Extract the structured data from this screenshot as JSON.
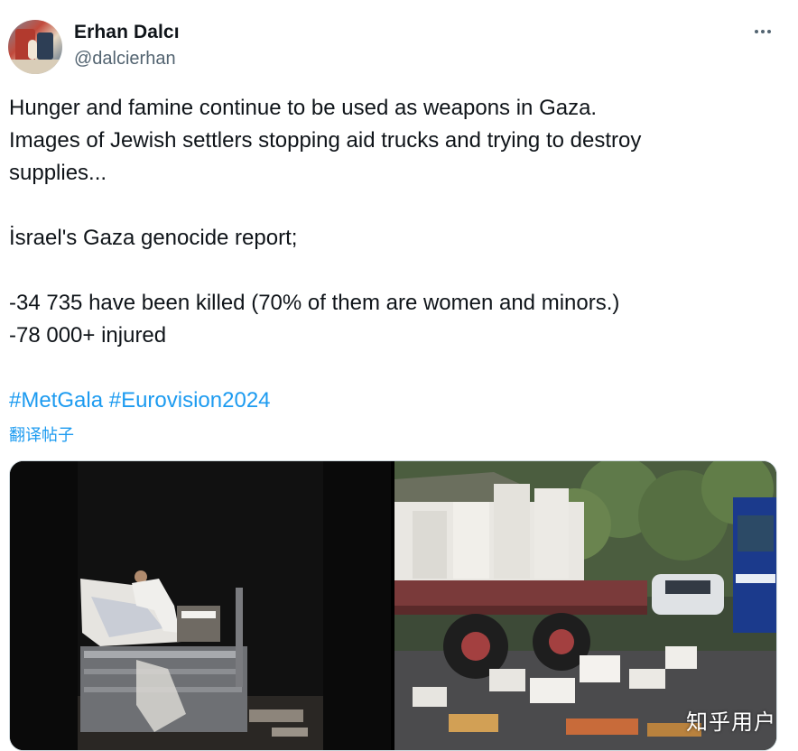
{
  "author": {
    "name": "Erhan Dalcı",
    "handle": "@dalcierhan"
  },
  "tweet": {
    "lines": [
      "Hunger and famine continue to be used as weapons in Gaza.",
      "Images of Jewish settlers stopping aid trucks and trying to destroy",
      "supplies...",
      "",
      "İsrael's Gaza genocide report;",
      "",
      "-34 735 have been killed (70% of them are women and minors.)",
      "-78 000+ injured",
      ""
    ],
    "hashtags": "#MetGala #Eurovision2024",
    "translate_label": "翻译帖子"
  },
  "media": {
    "watermark": "知乎用户"
  },
  "icons": {
    "more": "more-horizontal-icon"
  },
  "colors": {
    "link": "#1d9bf0",
    "secondary_text": "#536471"
  }
}
